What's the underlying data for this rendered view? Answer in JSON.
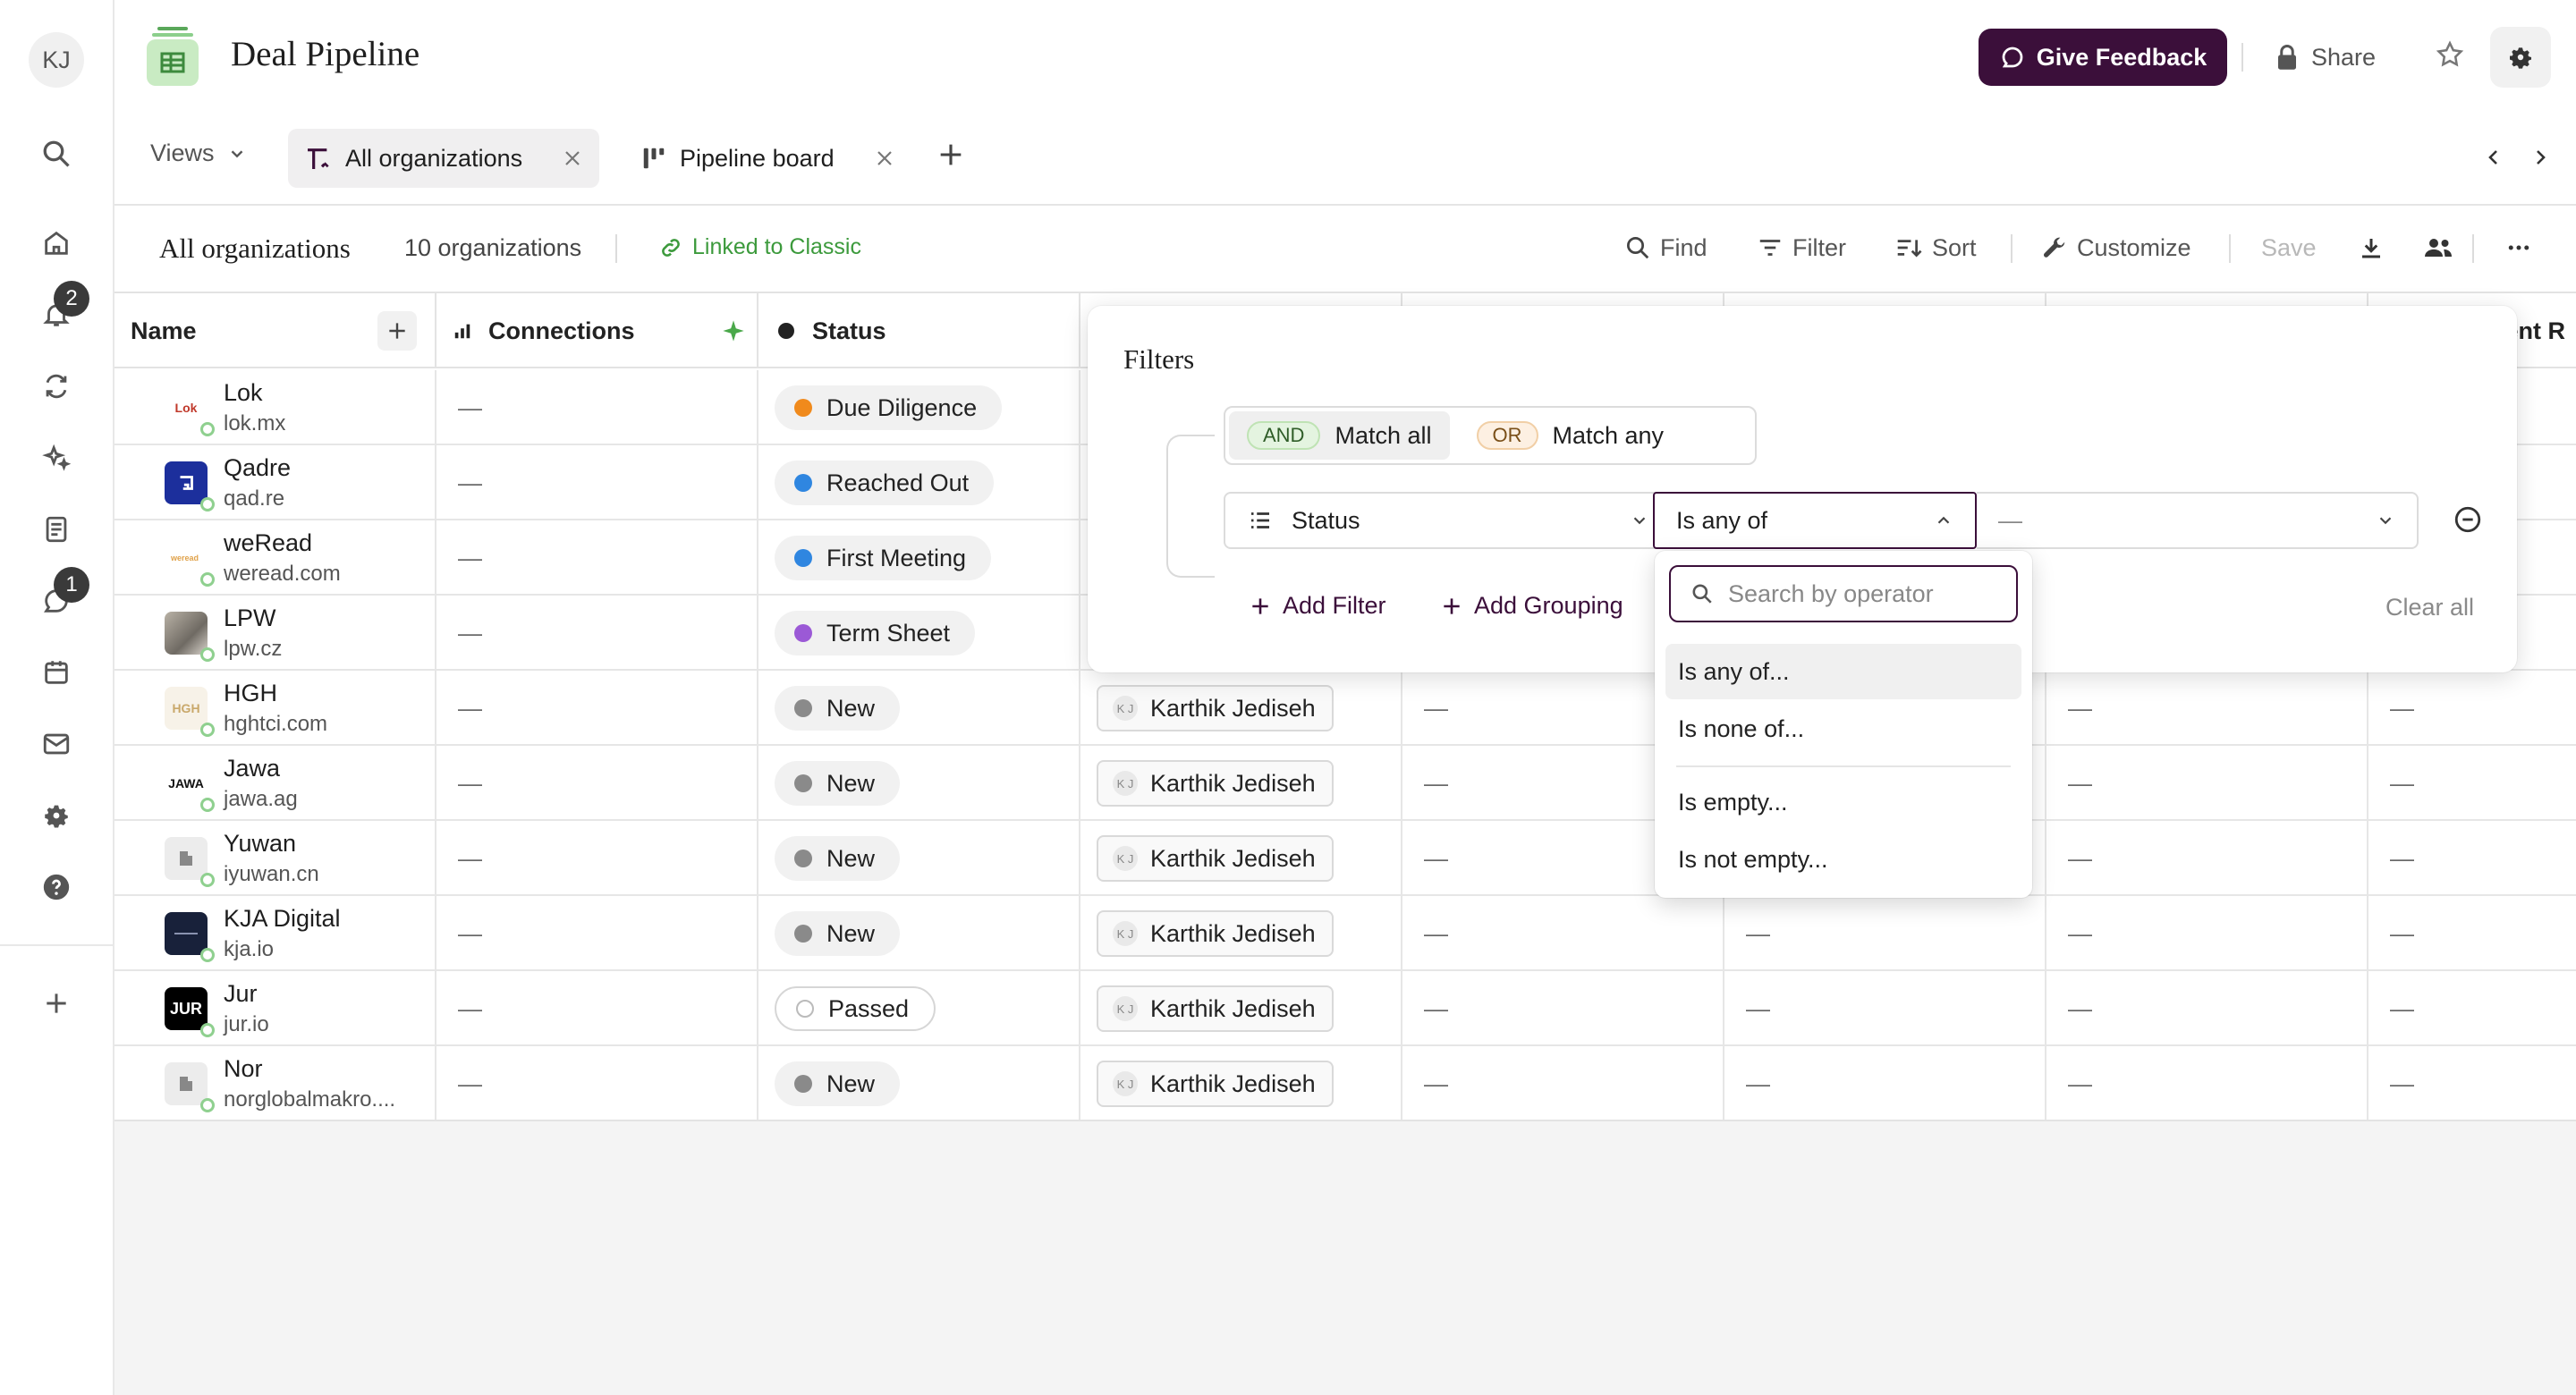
{
  "user": {
    "initials": "KJ"
  },
  "rail": {
    "notifications_badge": "2",
    "messages_badge": "1"
  },
  "header": {
    "title": "Deal Pipeline",
    "feedback_label": "Give Feedback",
    "share_label": "Share"
  },
  "tabs": {
    "views_label": "Views",
    "items": [
      {
        "label": "All organizations",
        "active": true
      },
      {
        "label": "Pipeline board",
        "active": false
      }
    ]
  },
  "toolbar": {
    "view_name": "All organizations",
    "count": "10 organizations",
    "linked": "Linked to Classic",
    "find": "Find",
    "filter": "Filter",
    "sort": "Sort",
    "customize": "Customize",
    "save": "Save"
  },
  "table": {
    "columns": [
      "Name",
      "Connections",
      "Status",
      "ent R"
    ],
    "rows": [
      {
        "name": "Lok",
        "domain": "lok.mx",
        "connections": "—",
        "status": "Due Diligence",
        "status_color": "#f08a1c",
        "owner": ""
      },
      {
        "name": "Qadre",
        "domain": "qad.re",
        "connections": "—",
        "status": "Reached Out",
        "status_color": "#2f86e0",
        "owner": ""
      },
      {
        "name": "weRead",
        "domain": "weread.com",
        "connections": "—",
        "status": "First Meeting",
        "status_color": "#2f86e0",
        "owner": ""
      },
      {
        "name": "LPW",
        "domain": "lpw.cz",
        "connections": "—",
        "status": "Term Sheet",
        "status_color": "#9b59d6",
        "owner": ""
      },
      {
        "name": "HGH",
        "domain": "hghtci.com",
        "connections": "—",
        "status": "New",
        "status_color": "#8a8a8a",
        "owner": "Karthik Jediseh"
      },
      {
        "name": "Jawa",
        "domain": "jawa.ag",
        "connections": "—",
        "status": "New",
        "status_color": "#8a8a8a",
        "owner": "Karthik Jediseh"
      },
      {
        "name": "Yuwan",
        "domain": "iyuwan.cn",
        "connections": "—",
        "status": "New",
        "status_color": "#8a8a8a",
        "owner": "Karthik Jediseh"
      },
      {
        "name": "KJA Digital",
        "domain": "kja.io",
        "connections": "—",
        "status": "New",
        "status_color": "#8a8a8a",
        "owner": "Karthik Jediseh"
      },
      {
        "name": "Jur",
        "domain": "jur.io",
        "connections": "—",
        "status": "Passed",
        "status_color": "#ffffff",
        "owner": "Karthik Jediseh"
      },
      {
        "name": "Nor",
        "domain": "norglobalmakro....",
        "connections": "—",
        "status": "New",
        "status_color": "#8a8a8a",
        "owner": "Karthik Jediseh"
      }
    ],
    "empty_value": "—",
    "logo_text": {
      "lok": "Lok",
      "hgh": "HGH",
      "jawa": "JAWA",
      "jur": "JUR"
    },
    "owner_initials": "K J"
  },
  "filters": {
    "title": "Filters",
    "and_tag": "AND",
    "and_label": "Match all",
    "or_tag": "OR",
    "or_label": "Match any",
    "field": "Status",
    "operator": "Is any of",
    "value": "—",
    "add_filter": "Add Filter",
    "add_grouping": "Add Grouping",
    "clear_all": "Clear all"
  },
  "operator_menu": {
    "search_placeholder": "Search by operator",
    "items": [
      "Is any of...",
      "Is none of...",
      "Is empty...",
      "Is not empty..."
    ]
  },
  "colors": {
    "brand": "#3b0f3a",
    "linked": "#3c9a3c",
    "accent_green": "#4aa84a"
  }
}
